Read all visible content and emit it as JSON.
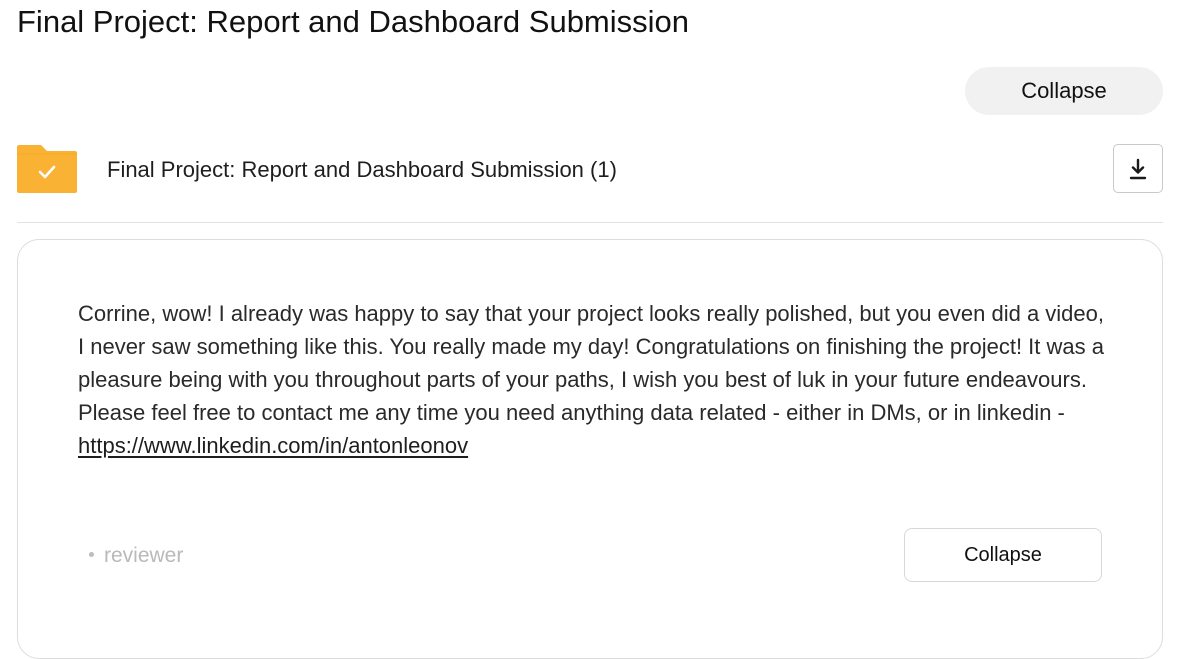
{
  "page": {
    "title": "Final Project: Report and Dashboard Submission"
  },
  "header": {
    "collapse_label": "Collapse"
  },
  "attachment": {
    "name": "Final Project: Report and Dashboard Submission (1)",
    "folder_icon": "folder-check-icon",
    "folder_color": "#F9B233",
    "download_icon": "download-icon"
  },
  "review": {
    "text": "Corrine, wow! I already was happy to say that your project looks really polished, but you even did a video, I never saw something like this. You really made my day! Congratulations on finishing the project! It was a pleasure being with you throughout parts of your paths, I wish you best of luk in your future endeavours. Please feel free to contact me any time you need anything data related - either in DMs, or in linkedin -",
    "link": "https://www.linkedin.com/in/antonleonov",
    "role": "reviewer",
    "collapse_label": "Collapse"
  }
}
